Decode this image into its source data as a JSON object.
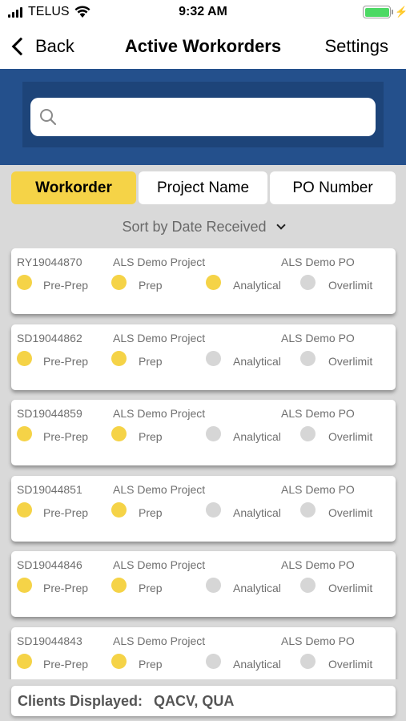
{
  "status_bar": {
    "carrier": "TELUS",
    "time": "9:32 AM",
    "battery_level": 1.0,
    "battery_color": "#4cd964"
  },
  "nav": {
    "back_label": "Back",
    "title": "Active Workorders",
    "settings_label": "Settings"
  },
  "search": {
    "value": "",
    "placeholder": ""
  },
  "segments": [
    {
      "label": "Workorder",
      "active": true
    },
    {
      "label": "Project Name",
      "active": false
    },
    {
      "label": "PO Number",
      "active": false
    }
  ],
  "sort": {
    "label": "Sort by Date Received"
  },
  "colors": {
    "accent_yellow": "#f5d347",
    "header_blue": "#24508c",
    "inactive_dot": "#d6d6d6"
  },
  "workorders": [
    {
      "id": "RY19044870",
      "project": "ALS Demo Project",
      "po": "ALS Demo PO",
      "stages": [
        {
          "label": "Pre-Prep",
          "done": true
        },
        {
          "label": "Prep",
          "done": true
        },
        {
          "label": "Analytical",
          "done": true
        },
        {
          "label": "Overlimit",
          "done": false
        }
      ]
    },
    {
      "id": "SD19044862",
      "project": "ALS Demo Project",
      "po": "ALS Demo PO",
      "stages": [
        {
          "label": "Pre-Prep",
          "done": true
        },
        {
          "label": "Prep",
          "done": true
        },
        {
          "label": "Analytical",
          "done": false
        },
        {
          "label": "Overlimit",
          "done": false
        }
      ]
    },
    {
      "id": "SD19044859",
      "project": "ALS Demo Project",
      "po": "ALS Demo PO",
      "stages": [
        {
          "label": "Pre-Prep",
          "done": true
        },
        {
          "label": "Prep",
          "done": true
        },
        {
          "label": "Analytical",
          "done": false
        },
        {
          "label": "Overlimit",
          "done": false
        }
      ]
    },
    {
      "id": "SD19044851",
      "project": "ALS Demo Project",
      "po": "ALS Demo PO",
      "stages": [
        {
          "label": "Pre-Prep",
          "done": true
        },
        {
          "label": "Prep",
          "done": true
        },
        {
          "label": "Analytical",
          "done": false
        },
        {
          "label": "Overlimit",
          "done": false
        }
      ]
    },
    {
      "id": "SD19044846",
      "project": "ALS Demo Project",
      "po": "ALS Demo PO",
      "stages": [
        {
          "label": "Pre-Prep",
          "done": true
        },
        {
          "label": "Prep",
          "done": true
        },
        {
          "label": "Analytical",
          "done": false
        },
        {
          "label": "Overlimit",
          "done": false
        }
      ]
    },
    {
      "id": "SD19044843",
      "project": "ALS Demo Project",
      "po": "ALS Demo PO",
      "stages": [
        {
          "label": "Pre-Prep",
          "done": true
        },
        {
          "label": "Prep",
          "done": true
        },
        {
          "label": "Analytical",
          "done": false
        },
        {
          "label": "Overlimit",
          "done": false
        }
      ]
    }
  ],
  "footer": {
    "label": "Clients Displayed:",
    "value": "QACV, QUA"
  }
}
